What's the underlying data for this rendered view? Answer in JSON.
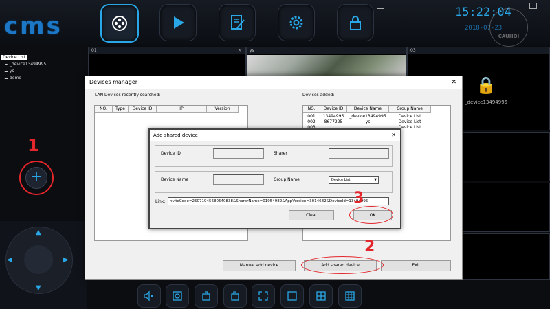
{
  "app": {
    "logo_text": "cms",
    "clock": "15:22:04",
    "date": "2018-07-23",
    "nav": [
      {
        "name": "camera-reel-icon",
        "active": true
      },
      {
        "name": "play-icon",
        "active": false
      },
      {
        "name": "edit-icon",
        "active": false
      },
      {
        "name": "gear-icon",
        "active": false
      },
      {
        "name": "lock-icon",
        "active": false
      }
    ],
    "watermark_text": "CAUHOI"
  },
  "sidebar": {
    "root_label": "Device List",
    "items": [
      "_device13494995",
      "ys",
      "demo"
    ]
  },
  "panes": [
    {
      "label": "01"
    },
    {
      "label": "ys"
    },
    {
      "label": "03"
    }
  ],
  "pane3_device": "_device13494995",
  "devices_manager": {
    "title": "Devices manager",
    "lan_label": "LAN Devices recently searched:",
    "added_label": "Devices added:",
    "lan_columns": [
      "NO.",
      "Type",
      "Device ID",
      "IP",
      "Version"
    ],
    "added_columns": [
      "NO.",
      "Device ID",
      "Device Name",
      "Group Name"
    ],
    "added_rows": [
      [
        "001",
        "13494995",
        "_device13494995",
        "Device List"
      ],
      [
        "002",
        "8677225",
        "ys",
        "Device List"
      ],
      [
        "003",
        "",
        "",
        "Device List"
      ]
    ],
    "manual_add_label": "Manual add device",
    "add_shared_label": "Add shared device",
    "exit_label": "Exit"
  },
  "shared_dialog": {
    "title": "Add shared device",
    "device_id_label": "Device ID",
    "sharer_label": "Sharer",
    "device_name_label": "Device Name",
    "group_name_label": "Group Name",
    "group_value": "Device List",
    "link_label": "Link:",
    "link_value": "nviteCode=25071945680540838&SharerName=01954982&AppVersion=3014682&DeviceId=13494995",
    "clear_label": "Clear",
    "ok_label": "OK"
  },
  "annotations": {
    "step1": "1",
    "step2": "2",
    "step3": "3"
  },
  "colors": {
    "accent": "#2aa7e6",
    "annotation": "#e3262b",
    "logo": "#1c78c7"
  },
  "toolbar": [
    "mute-icon",
    "snapshot-icon",
    "record-start-icon",
    "record-stop-icon",
    "fullscreen-icon",
    "layout-1-icon",
    "layout-4-icon",
    "layout-9-icon"
  ]
}
